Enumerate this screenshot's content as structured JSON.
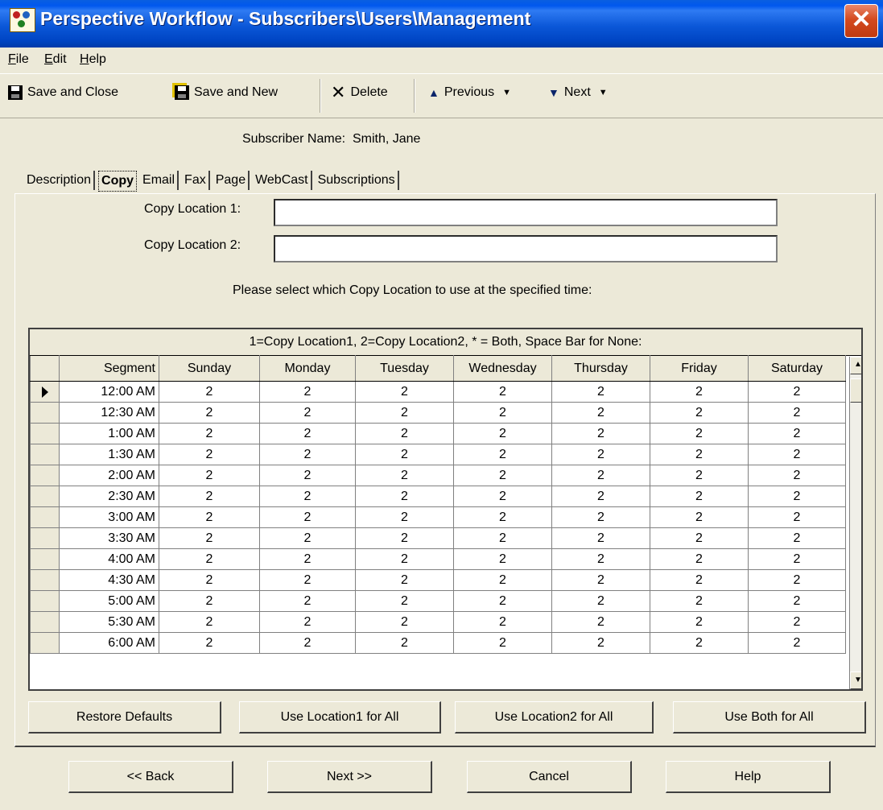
{
  "window": {
    "title": "Perspective Workflow - Subscribers\\Users\\Management"
  },
  "menu": [
    {
      "label": "File"
    },
    {
      "label": "Edit"
    },
    {
      "label": "Help"
    }
  ],
  "toolbar": {
    "save_close": "Save and Close",
    "save_new": "Save and New",
    "delete": "Delete",
    "previous": "Previous",
    "next": "Next"
  },
  "subscriber": {
    "label": "Subscriber Name:",
    "name": "Smith, Jane"
  },
  "tabs": [
    {
      "label": "Description"
    },
    {
      "label": "Copy"
    },
    {
      "label": "Email"
    },
    {
      "label": "Fax"
    },
    {
      "label": "Page"
    },
    {
      "label": "WebCast"
    },
    {
      "label": "Subscriptions"
    }
  ],
  "copy": {
    "location1_label": "Copy Location 1:",
    "location1_value": "",
    "location2_label": "Copy Location 2:",
    "location2_value": "",
    "prompt": "Please select which Copy Location to use at the specified time:"
  },
  "grid": {
    "caption": "1=Copy Location1, 2=Copy Location2, * = Both, Space Bar for None:",
    "columns": [
      "Segment",
      "Sunday",
      "Monday",
      "Tuesday",
      "Wednesday",
      "Thursday",
      "Friday",
      "Saturday"
    ],
    "rows": [
      {
        "segment": "12:00 AM",
        "values": [
          "2",
          "2",
          "2",
          "2",
          "2",
          "2",
          "2"
        ]
      },
      {
        "segment": "12:30 AM",
        "values": [
          "2",
          "2",
          "2",
          "2",
          "2",
          "2",
          "2"
        ]
      },
      {
        "segment": "1:00 AM",
        "values": [
          "2",
          "2",
          "2",
          "2",
          "2",
          "2",
          "2"
        ]
      },
      {
        "segment": "1:30 AM",
        "values": [
          "2",
          "2",
          "2",
          "2",
          "2",
          "2",
          "2"
        ]
      },
      {
        "segment": "2:00 AM",
        "values": [
          "2",
          "2",
          "2",
          "2",
          "2",
          "2",
          "2"
        ]
      },
      {
        "segment": "2:30 AM",
        "values": [
          "2",
          "2",
          "2",
          "2",
          "2",
          "2",
          "2"
        ]
      },
      {
        "segment": "3:00 AM",
        "values": [
          "2",
          "2",
          "2",
          "2",
          "2",
          "2",
          "2"
        ]
      },
      {
        "segment": "3:30 AM",
        "values": [
          "2",
          "2",
          "2",
          "2",
          "2",
          "2",
          "2"
        ]
      },
      {
        "segment": "4:00 AM",
        "values": [
          "2",
          "2",
          "2",
          "2",
          "2",
          "2",
          "2"
        ]
      },
      {
        "segment": "4:30 AM",
        "values": [
          "2",
          "2",
          "2",
          "2",
          "2",
          "2",
          "2"
        ]
      },
      {
        "segment": "5:00 AM",
        "values": [
          "2",
          "2",
          "2",
          "2",
          "2",
          "2",
          "2"
        ]
      },
      {
        "segment": "5:30 AM",
        "values": [
          "2",
          "2",
          "2",
          "2",
          "2",
          "2",
          "2"
        ]
      },
      {
        "segment": "6:00 AM",
        "values": [
          "2",
          "2",
          "2",
          "2",
          "2",
          "2",
          "2"
        ]
      }
    ]
  },
  "panel_buttons": {
    "restore": "Restore Defaults",
    "use1": "Use Location1 for All",
    "use2": "Use Location2 for All",
    "both": "Use Both for All"
  },
  "nav_buttons": {
    "back": "<< Back",
    "next": "Next >>",
    "cancel": "Cancel",
    "help": "Help"
  }
}
